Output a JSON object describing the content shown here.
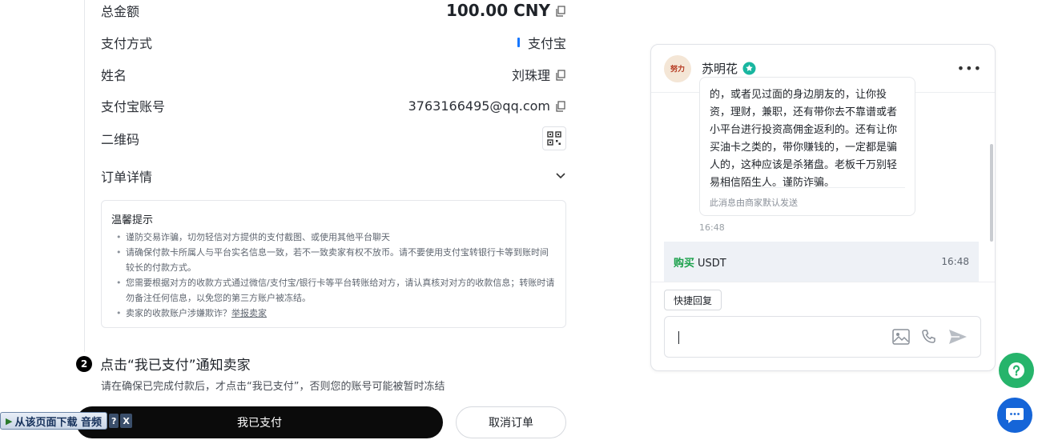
{
  "order": {
    "total_label": "总金额",
    "total_value": "100.00 CNY",
    "payment_method_label": "支付方式",
    "payment_method_value": "支付宝",
    "name_label": "姓名",
    "name_value": "刘珠理",
    "account_label": "支付宝账号",
    "account_value": "3763166495@qq.com",
    "qrcode_label": "二维码",
    "details_label": "订单详情"
  },
  "tips": {
    "title": "温馨提示",
    "items": [
      "谨防交易诈骗，切勿轻信对方提供的支付截图、或使用其他平台聊天",
      "请确保付款卡所属人与平台实名信息一致，若不一致卖家有权不放币。请不要使用支付宝转银行卡等到账时间较长的付款方式。",
      "您需要根据对方的收款方式通过微信/支付宝/银行卡等平台转账给对方，请认真核对对方的收款信息；转账时请勿备注任何信息，以免您的第三方账户被冻结。"
    ],
    "last_item_text": "卖家的收款账户涉嫌欺诈？",
    "report_link": "举报卖家"
  },
  "step": {
    "number": "2",
    "title": "点击“我已支付”通知卖家",
    "description": "请在确保已完成付款后，才点击“我已支付”，否则您的账号可能被暂时冻结"
  },
  "buttons": {
    "paid": "我已支付",
    "cancel": "取消订单"
  },
  "download_bar": {
    "label": "从该页面下载 音频",
    "help": "?",
    "close": "X"
  },
  "chat": {
    "seller_name": "苏明花",
    "avatar_text": "努力",
    "message_text": "的，或者见过面的身边朋友的，让你投资，理财，兼职，还有带你去不靠谱或者小平台进行投资高佣金返利的。还有让你买油卡之类的，带你赚钱的，一定都是骗人的，这种应该是杀猪盘。老板千万别轻易相信陌生人。谨防诈骗。",
    "message_note": "此消息由商家默认发送",
    "message_time": "16:48",
    "order_card": {
      "action": "购买",
      "asset": "USDT",
      "time": "16:48"
    },
    "quick_reply": "快捷回复",
    "input_value": ""
  },
  "colors": {
    "primary_button": "#0b0b0b",
    "buy_green": "#1aa04a",
    "help_fab": "#26b46b",
    "chat_fab": "#1565d8",
    "alipay_blue": "#1677ff"
  }
}
